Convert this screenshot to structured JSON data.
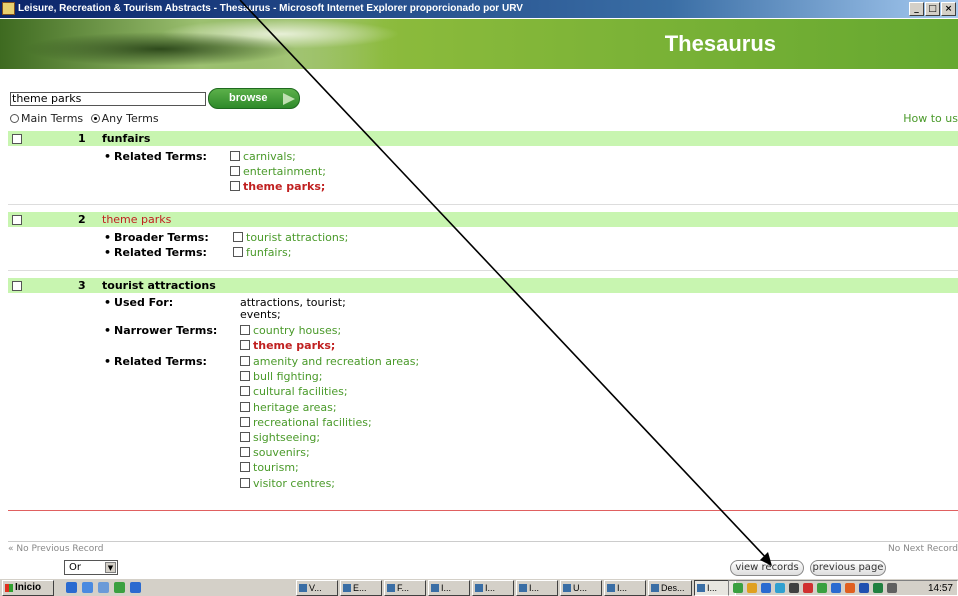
{
  "window": {
    "title": "Leisure, Recreation & Tourism Abstracts - Thesaurus - Microsoft Internet Explorer proporcionado por URV",
    "buttons": [
      "_",
      "B",
      "X"
    ]
  },
  "banner": {
    "title": "Thesaurus"
  },
  "search": {
    "value": "theme parks",
    "browse_label": "browse"
  },
  "mode": {
    "main_terms": "Main Terms",
    "any_terms": "Any Terms",
    "selected": "Any Terms",
    "howto": "How to us"
  },
  "terms": [
    {
      "num": "1",
      "term": "funfairs",
      "groups": [
        {
          "label": "Related Terms:",
          "items": [
            "carnivals;",
            "entertainment;",
            "theme parks;"
          ]
        }
      ]
    },
    {
      "num": "2",
      "term": "theme parks",
      "groups": [
        {
          "label": "Broader Terms:",
          "items": [
            "tourist attractions;"
          ]
        },
        {
          "label": "Related Terms:",
          "items": [
            "funfairs;"
          ]
        }
      ]
    },
    {
      "num": "3",
      "term": "tourist attractions",
      "groups": [
        {
          "label": "Used For:",
          "plain": [
            "attractions, tourist;",
            "events;"
          ]
        },
        {
          "label": "Narrower Terms:",
          "items": [
            "country houses;",
            "theme parks;"
          ]
        },
        {
          "label": "Related Terms:",
          "items": [
            "amenity and recreation areas;",
            "bull fighting;",
            "cultural facilities;",
            "heritage areas;",
            "recreational facilities;",
            "sightseeing;",
            "souvenirs;",
            "tourism;",
            "visitor centres;"
          ]
        }
      ]
    }
  ],
  "nav": {
    "prev": "« No Previous Record",
    "next": "No Next Record"
  },
  "bottom": {
    "operator": "Or",
    "view_records": "view records",
    "previous_page": "previous page"
  },
  "taskbar": {
    "start": "Inicio",
    "buttons": [
      "V...",
      "E...",
      "F...",
      "I...",
      "I...",
      "I...",
      "U...",
      "I...",
      "Des...",
      "I..."
    ],
    "clock": "14:57"
  },
  "colors": {
    "accent_green": "#4a9a2a",
    "highlight_red": "#c02020",
    "term_bar": "#c8f5b0"
  }
}
